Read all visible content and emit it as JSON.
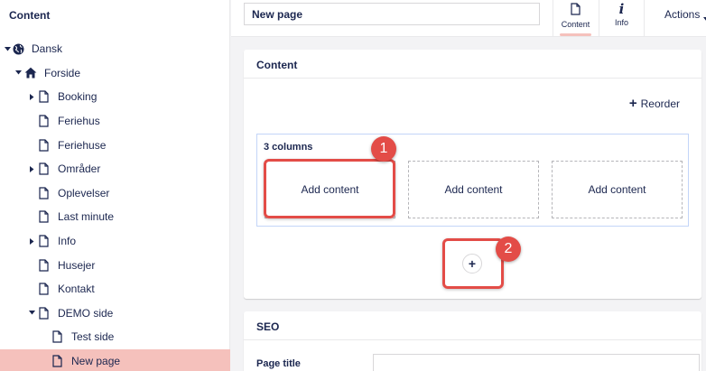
{
  "sidebar": {
    "header": "Content",
    "tree": [
      {
        "label": "Dansk",
        "icon": "globe-icon",
        "caret": "down",
        "level": 0
      },
      {
        "label": "Forside",
        "icon": "home-icon",
        "caret": "down",
        "level": 1
      },
      {
        "label": "Booking",
        "icon": "document-icon",
        "caret": "right",
        "level": 2
      },
      {
        "label": "Feriehus",
        "icon": "document-icon",
        "caret": "",
        "level": 2
      },
      {
        "label": "Feriehuse",
        "icon": "document-icon",
        "caret": "",
        "level": 2
      },
      {
        "label": "Områder",
        "icon": "document-icon",
        "caret": "right",
        "level": 2
      },
      {
        "label": "Oplevelser",
        "icon": "document-icon",
        "caret": "",
        "level": 2
      },
      {
        "label": "Last minute",
        "icon": "document-icon",
        "caret": "",
        "level": 2
      },
      {
        "label": "Info",
        "icon": "document-icon",
        "caret": "right",
        "level": 2
      },
      {
        "label": "Husejer",
        "icon": "document-icon",
        "caret": "",
        "level": 2
      },
      {
        "label": "Kontakt",
        "icon": "document-icon",
        "caret": "",
        "level": 2
      },
      {
        "label": "DEMO side",
        "icon": "document-icon",
        "caret": "down",
        "level": 2
      },
      {
        "label": "Test side",
        "icon": "document-icon",
        "caret": "",
        "level": 3
      },
      {
        "label": "New page",
        "icon": "document-icon",
        "caret": "",
        "level": 3,
        "active": true
      }
    ]
  },
  "topbar": {
    "page_name": "New page",
    "tabs": [
      {
        "label": "Content",
        "icon": "document-icon",
        "active": true
      },
      {
        "label": "Info",
        "icon": "info-icon",
        "active": false
      }
    ],
    "actions_label": "Actions"
  },
  "content_panel": {
    "title": "Content",
    "reorder_label": "Reorder",
    "grid": {
      "title": "3 columns",
      "cells": [
        "Add content",
        "Add content",
        "Add content"
      ]
    },
    "add_row_symbol": "+"
  },
  "seo_panel": {
    "title": "SEO",
    "page_title_label": "Page title",
    "page_title_value": ""
  },
  "callouts": [
    "1",
    "2"
  ],
  "colors": {
    "accent": "#f5c1bc",
    "text": "#1b264f",
    "callout": "#e34c47",
    "grid_border": "#c3d5f8"
  }
}
